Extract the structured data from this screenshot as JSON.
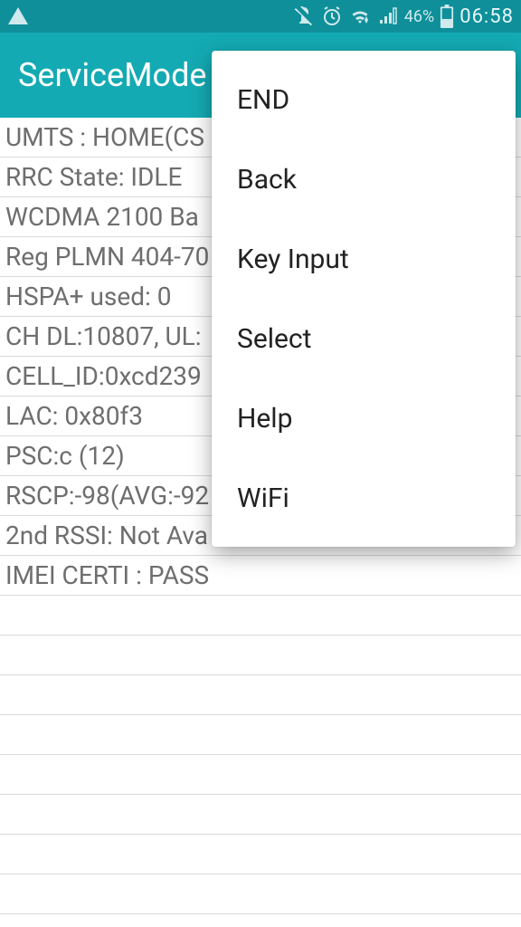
{
  "statusbar": {
    "battery_pct": "46%",
    "clock": "06:58"
  },
  "appbar": {
    "title": "ServiceMode"
  },
  "rows": [
    "UMTS : HOME(CS",
    "RRC State: IDLE",
    "WCDMA 2100 Ba",
    "Reg PLMN 404-70",
    "HSPA+ used: 0",
    "CH DL:10807, UL:",
    "CELL_ID:0xcd239",
    "LAC: 0x80f3",
    "PSC:c (12)",
    "RSCP:-98(AVG:-92",
    "2nd RSSI: Not Ava",
    "IMEI CERTI : PASS",
    "",
    "",
    "",
    "",
    "",
    "",
    "",
    ""
  ],
  "menu": {
    "items": [
      "END",
      "Back",
      "Key Input",
      "Select",
      "Help",
      "WiFi"
    ]
  }
}
